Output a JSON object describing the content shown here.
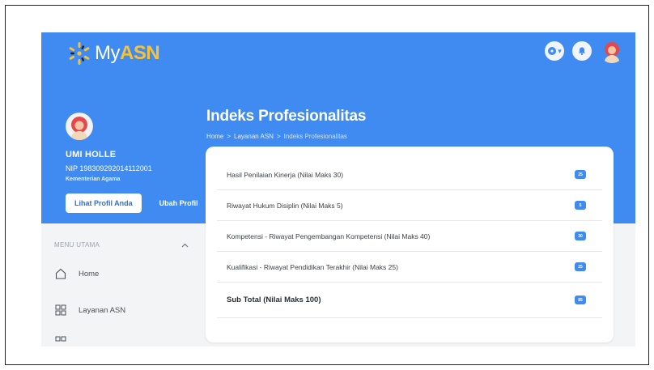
{
  "brand": {
    "name_prefix": "My",
    "name_suffix": "ASN"
  },
  "profile": {
    "name": "UMI HOLLE",
    "nip": "NIP 198309292014112001",
    "agency": "Kementerian Agama",
    "view_profile_label": "Lihat Profil Anda",
    "edit_profile_label": "Ubah Profil"
  },
  "page": {
    "title": "Indeks Profesionalitas",
    "breadcrumb": [
      "Home",
      ">",
      "Layanan ASN",
      ">",
      "Indeks Profesionalitas"
    ]
  },
  "sidebar": {
    "section_label": "MENU UTAMA",
    "items": [
      {
        "label": "Home",
        "icon": "home-icon"
      },
      {
        "label": "Layanan ASN",
        "icon": "grid-icon"
      },
      {
        "label": "",
        "icon": "grid-icon"
      }
    ]
  },
  "index_rows": [
    {
      "label": "Hasil Penilaian Kinerja (Nilai Maks 30)",
      "value": "25"
    },
    {
      "label": "Riwayat Hukum Disiplin (Nilai Maks 5)",
      "value": "5"
    },
    {
      "label": "Kompetensi - Riwayat Pengembangan Kompetensi (Nilai Maks 40)",
      "value": "30"
    },
    {
      "label": "Kualifikasi - Riwayat Pendidikan Terakhir (Nilai Maks 25)",
      "value": "25"
    }
  ],
  "subtotal": {
    "label": "Sub Total (Nilai Maks 100)",
    "value": "85"
  },
  "colors": {
    "primary": "#3f8bf2",
    "accent": "#f6c23a",
    "background": "#f3f4f6"
  }
}
